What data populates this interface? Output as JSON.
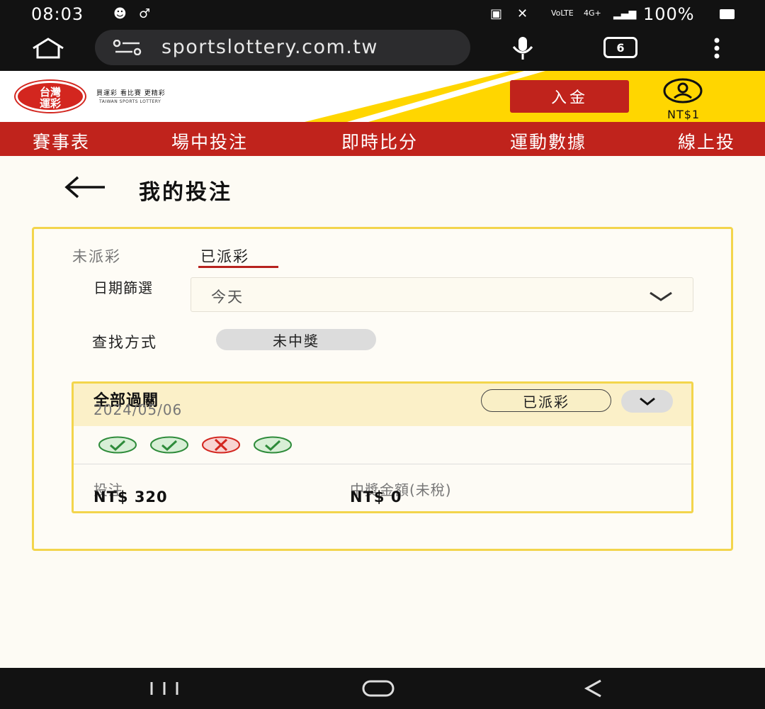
{
  "status_bar": {
    "time": "08:03",
    "battery": "100%",
    "network": "4G+",
    "volte": "VoLTE"
  },
  "browser": {
    "url": "sportslottery.com.tw",
    "tab_count": "6"
  },
  "header": {
    "logo_text_line1": "台灣",
    "logo_text_line2": "運彩",
    "logo_tagline": "買運彩 看比賽 更精彩",
    "logo_subtitle": "TAIWAN SPORTS LOTTERY",
    "deposit_label": "入金",
    "balance": "NT$1"
  },
  "nav": {
    "items": [
      "賽事表",
      "場中投注",
      "即時比分",
      "運動數據",
      "線上投"
    ]
  },
  "page": {
    "title": "我的投注"
  },
  "tabs": {
    "unpaid": "未派彩",
    "paid": "已派彩",
    "active": "paid"
  },
  "filters": {
    "date_label": "日期篩選",
    "date_value": "今天",
    "search_label": "查找方式",
    "search_value": "未中獎"
  },
  "bet_card": {
    "title": "全部過關",
    "date": "2024/05/06",
    "status": "已派彩",
    "results": [
      "win",
      "win",
      "lose",
      "win"
    ],
    "stake_label": "投注",
    "stake_value": "NT$ 320",
    "payout_label": "中獎金額(未稅)",
    "payout_value": "NT$ 0"
  },
  "colors": {
    "brand_red": "#c0231c",
    "brand_yellow": "#ffd600",
    "win_green": "#2e8b3a",
    "lose_red": "#d3261f"
  }
}
